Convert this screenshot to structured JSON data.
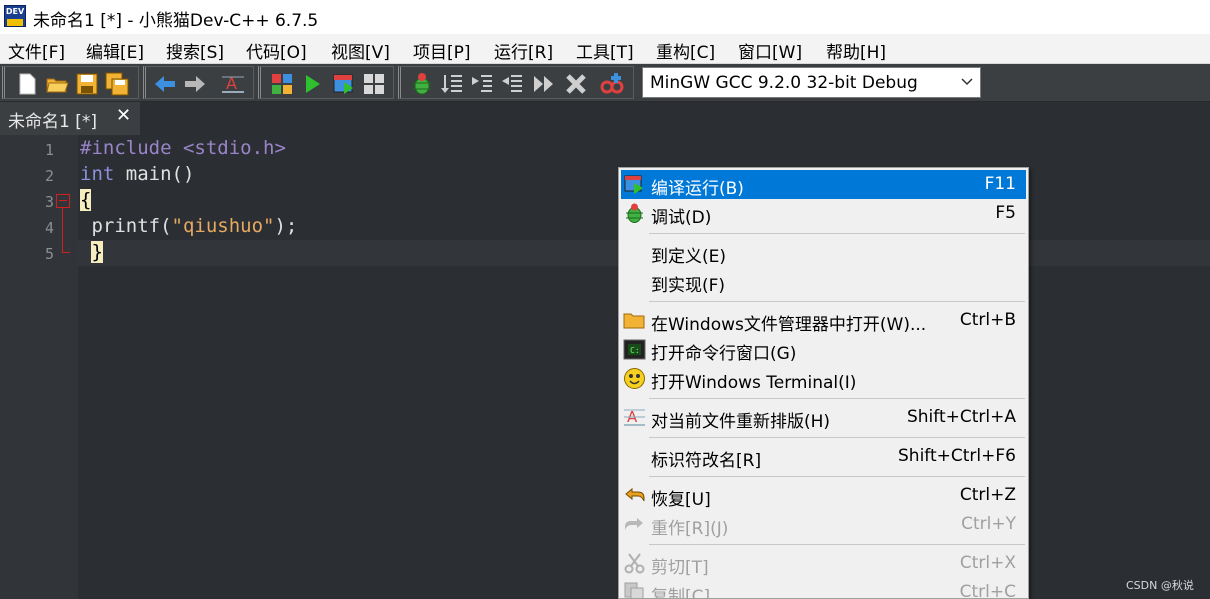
{
  "window": {
    "title": "未命名1 [*] - 小熊猫Dev-C++ 6.7.5",
    "app_icon_text": "DEV"
  },
  "menubar": {
    "items": [
      "文件[F]",
      "编辑[E]",
      "搜索[S]",
      "代码[O]",
      "视图[V]",
      "项目[P]",
      "运行[R]",
      "工具[T]",
      "重构[C]",
      "窗口[W]",
      "帮助[H]"
    ]
  },
  "toolbar": {
    "compiler_selected": "MinGW GCC 9.2.0 32-bit Debug",
    "icons": [
      "new-file-icon",
      "open-folder-icon",
      "save-icon",
      "save-all-icon",
      "back-arrow-icon",
      "forward-arrow-icon",
      "reformat-icon",
      "compile-icon",
      "run-icon",
      "compile-run-icon",
      "rebuild-icon",
      "debug-bug-icon",
      "step-over-icon",
      "step-into-icon",
      "step-out-icon",
      "continue-icon",
      "stop-icon",
      "add-watch-icon"
    ]
  },
  "tabs": [
    {
      "label": "未命名1 [*]",
      "close": "✕"
    }
  ],
  "editor": {
    "line_numbers": [
      "1",
      "2",
      "3",
      "4",
      "5"
    ],
    "lines": {
      "l1_directive": "#include",
      "l1_header": " <stdio.h>",
      "l2_type": "int",
      "l2_rest": " main()",
      "l3_brace": "{",
      "l4_call": " printf(",
      "l4_string": "\"qiushuo\"",
      "l4_end": ");",
      "l5_indent": " ",
      "l5_brace": "}"
    },
    "colors": {
      "background": "#2b2f33",
      "gutter": "#313438",
      "keyword": "#8a8fd8",
      "string": "#e8a860",
      "fold_marker": "#d02020"
    }
  },
  "context_menu": {
    "items": [
      {
        "label": "编译运行(B)",
        "shortcut": "F11",
        "icon": "compile-run-icon",
        "state": "highlighted"
      },
      {
        "label": "调试(D)",
        "shortcut": "F5",
        "icon": "debug-bug-icon",
        "state": "enabled"
      },
      {
        "label": "到定义(E)",
        "shortcut": "",
        "icon": "",
        "state": "enabled"
      },
      {
        "label": "到实现(F)",
        "shortcut": "",
        "icon": "",
        "state": "enabled"
      },
      {
        "label": "在Windows文件管理器中打开(W)...",
        "shortcut": "Ctrl+B",
        "icon": "folder-icon",
        "state": "enabled"
      },
      {
        "label": "打开命令行窗口(G)",
        "shortcut": "",
        "icon": "terminal-icon",
        "state": "enabled"
      },
      {
        "label": "打开Windows Terminal(I)",
        "shortcut": "",
        "icon": "smiley-icon",
        "state": "enabled"
      },
      {
        "label": "对当前文件重新排版(H)",
        "shortcut": "Shift+Ctrl+A",
        "icon": "reformat-icon",
        "state": "enabled"
      },
      {
        "label": "标识符改名[R]",
        "shortcut": "Shift+Ctrl+F6",
        "icon": "",
        "state": "enabled"
      },
      {
        "label": "恢复[U]",
        "shortcut": "Ctrl+Z",
        "icon": "undo-icon",
        "state": "enabled"
      },
      {
        "label": "重作[R](J)",
        "shortcut": "Ctrl+Y",
        "icon": "redo-icon",
        "state": "disabled"
      },
      {
        "label": "剪切[T]",
        "shortcut": "Ctrl+X",
        "icon": "cut-icon",
        "state": "disabled"
      },
      {
        "label": "复制[C]",
        "shortcut": "Ctrl+C",
        "icon": "copy-icon",
        "state": "disabled"
      }
    ],
    "highlight_color": "#0078d7"
  },
  "watermark": "CSDN @秋说"
}
